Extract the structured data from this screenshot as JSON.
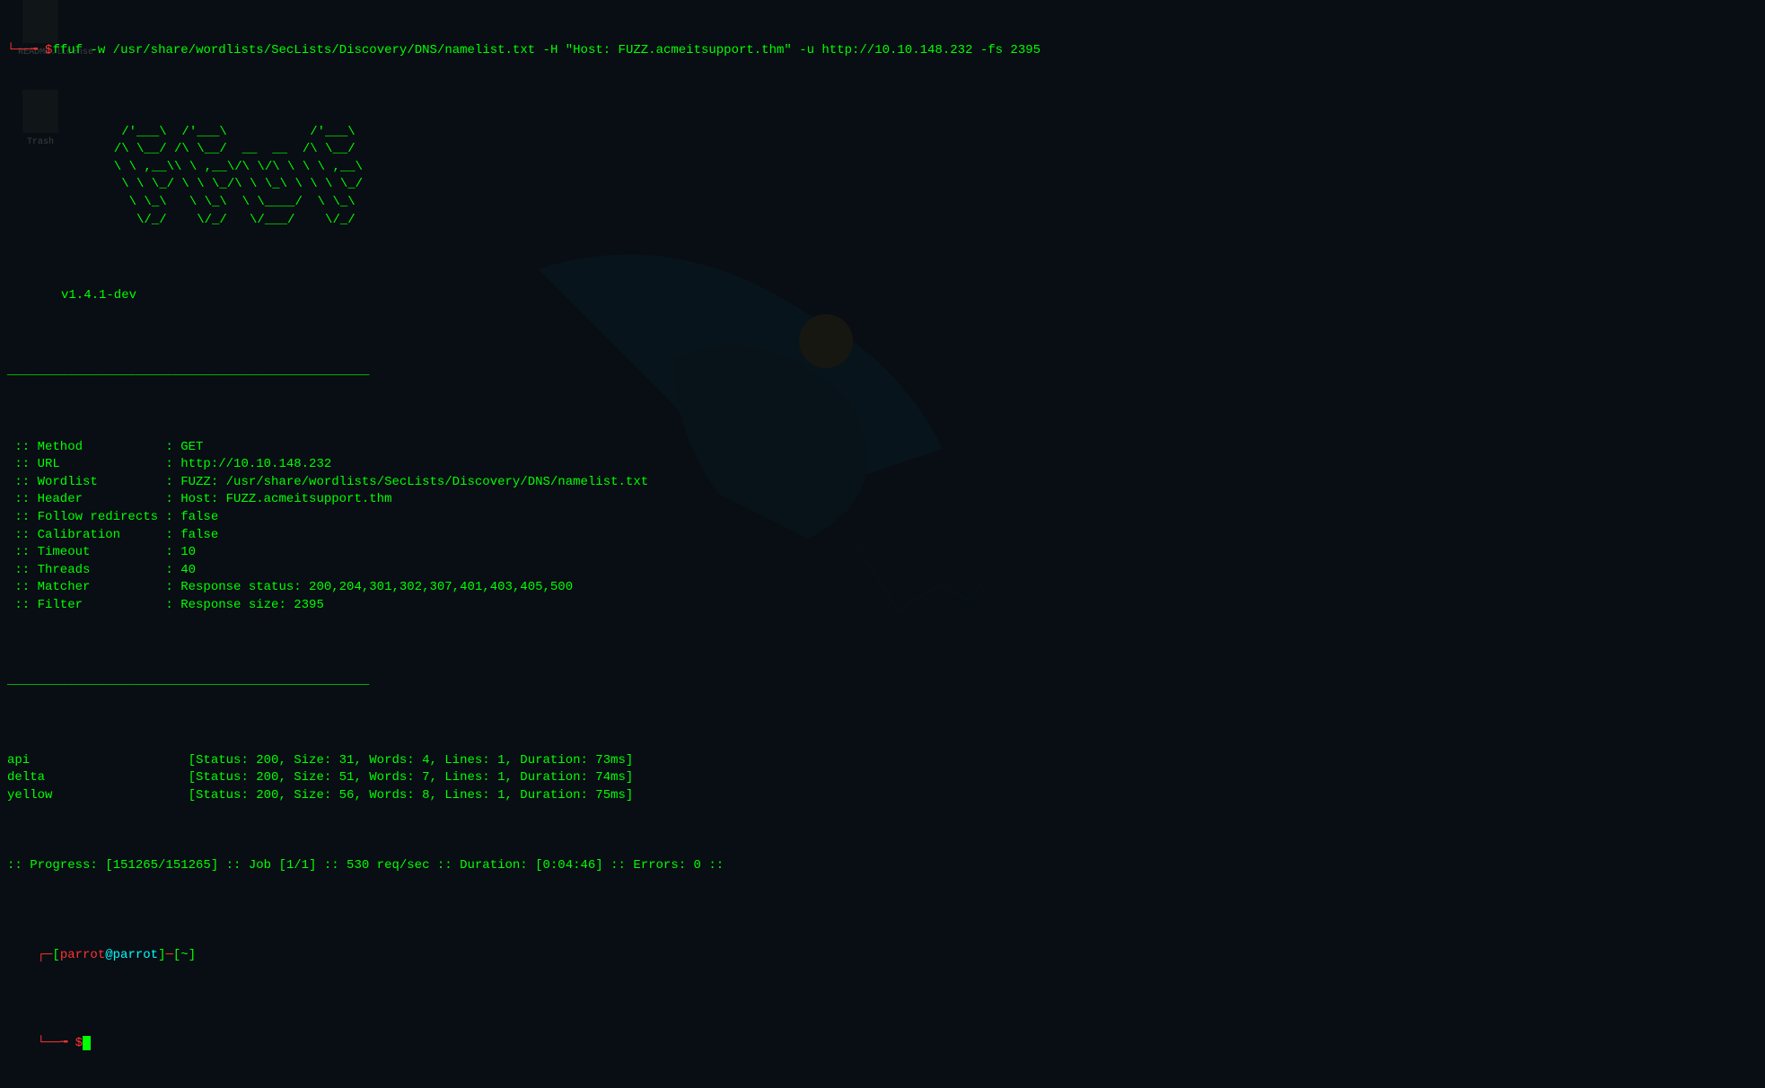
{
  "desktop": {
    "icon1": "README.license",
    "icon2": "Trash"
  },
  "command": {
    "prefix": "└──╼ ",
    "dollar": "$",
    "text": "ffuf -w /usr/share/wordlists/SecLists/Discovery/DNS/namelist.txt -H \"Host: FUZZ.acmeitsupport.thm\" -u http://10.10.148.232 -fs 2395"
  },
  "ascii": "        /'___\\  /'___\\           /'___\\       \n       /\\ \\__/ /\\ \\__/  __  __  /\\ \\__/       \n       \\ \\ ,__\\\\ \\ ,__\\/\\ \\/\\ \\ \\ \\ ,__\\      \n        \\ \\ \\_/ \\ \\ \\_/\\ \\ \\_\\ \\ \\ \\ \\_/      \n         \\ \\_\\   \\ \\_\\  \\ \\____/  \\ \\_\\       \n          \\/_/    \\/_/   \\/___/    \\/_/       ",
  "version": "v1.4.1-dev",
  "divider": "________________________________________________",
  "config": [
    {
      "label": "Method",
      "value": "GET"
    },
    {
      "label": "URL",
      "value": "http://10.10.148.232"
    },
    {
      "label": "Wordlist",
      "value": "FUZZ: /usr/share/wordlists/SecLists/Discovery/DNS/namelist.txt"
    },
    {
      "label": "Header",
      "value": "Host: FUZZ.acmeitsupport.thm"
    },
    {
      "label": "Follow redirects",
      "value": "false"
    },
    {
      "label": "Calibration",
      "value": "false"
    },
    {
      "label": "Timeout",
      "value": "10"
    },
    {
      "label": "Threads",
      "value": "40"
    },
    {
      "label": "Matcher",
      "value": "Response status: 200,204,301,302,307,401,403,405,500"
    },
    {
      "label": "Filter",
      "value": "Response size: 2395"
    }
  ],
  "results": [
    {
      "name": "api",
      "status": "200",
      "size": "31",
      "words": "4",
      "lines": "1",
      "duration": "73ms"
    },
    {
      "name": "delta",
      "status": "200",
      "size": "51",
      "words": "7",
      "lines": "1",
      "duration": "74ms"
    },
    {
      "name": "yellow",
      "status": "200",
      "size": "56",
      "words": "8",
      "lines": "1",
      "duration": "75ms"
    }
  ],
  "progress": {
    "done": "151265",
    "total": "151265",
    "job": "1/1",
    "rate": "530 req/sec",
    "duration": "0:04:46",
    "errors": "0"
  },
  "shell": {
    "bracket_open": "[",
    "user": "parrot",
    "at": "@",
    "host": "parrot",
    "bracket_close": "]",
    "dash": "─",
    "path_open": "[",
    "path": "~",
    "path_close": "]",
    "corner1": "┌─",
    "corner2": "└──╼ ",
    "dollar": "$"
  }
}
